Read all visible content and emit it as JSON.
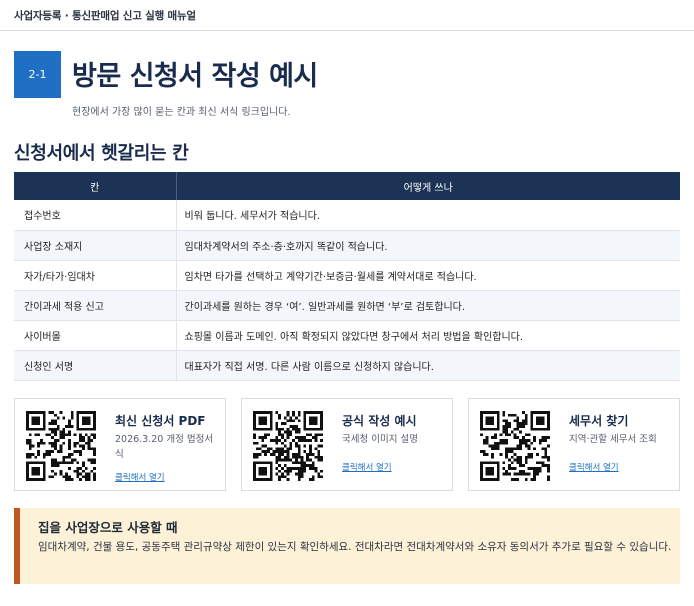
{
  "breadcrumb": "사업자등록 · 통신판매업 신고 실행 매뉴얼",
  "header": {
    "section_number": "2-1",
    "title": "방문 신청서 작성 예시",
    "subtitle": "현장에서 가장 많이 묻는 칸과 최신 서식 링크입니다."
  },
  "table_section": {
    "heading": "신청서에서 헷갈리는 칸",
    "columns": [
      "칸",
      "어떻게 쓰나"
    ],
    "rows": [
      [
        "접수번호",
        "비워 둡니다. 세무서가 적습니다."
      ],
      [
        "사업장 소재지",
        "임대차계약서의 주소·층·호까지 똑같이 적습니다."
      ],
      [
        "자가/타가·임대차",
        "임차면 타가를 선택하고 계약기간·보증금·월세를 계약서대로 적습니다."
      ],
      [
        "간이과세 적용 신고",
        "간이과세를 원하는 경우 ‘여’. 일반과세를 원하면 ‘부’로 검토합니다."
      ],
      [
        "사이버몰",
        "쇼핑몰 이름과 도메인. 아직 확정되지 않았다면 창구에서 처리 방법을 확인합니다."
      ],
      [
        "신청인 서명",
        "대표자가 직접 서명. 다른 사람 이름으로 신청하지 않습니다."
      ]
    ]
  },
  "cards": [
    {
      "title": "최신 신청서 PDF",
      "desc": "2026.3.20 개정 법정서식",
      "link": "클릭해서 열기"
    },
    {
      "title": "공식 작성 예시",
      "desc": "국세청 이미지 설명",
      "link": "클릭해서 열기"
    },
    {
      "title": "세무서 찾기",
      "desc": "지역·관할 세무서 조회",
      "link": "클릭해서 열기"
    }
  ],
  "notice": {
    "title": "집을 사업장으로 사용할 때",
    "body": "임대차계약, 건물 용도, 공동주택 관리규약상 제한이 있는지 확인하세요. 전대차라면 전대차계약서와 소유자 동의서가 추가로 필요할 수 있습니다."
  },
  "colors": {
    "accent": "#1f6fc5",
    "table_header": "#1c3356",
    "notice_bg": "#fdf1d8",
    "notice_border": "#c0571d"
  }
}
